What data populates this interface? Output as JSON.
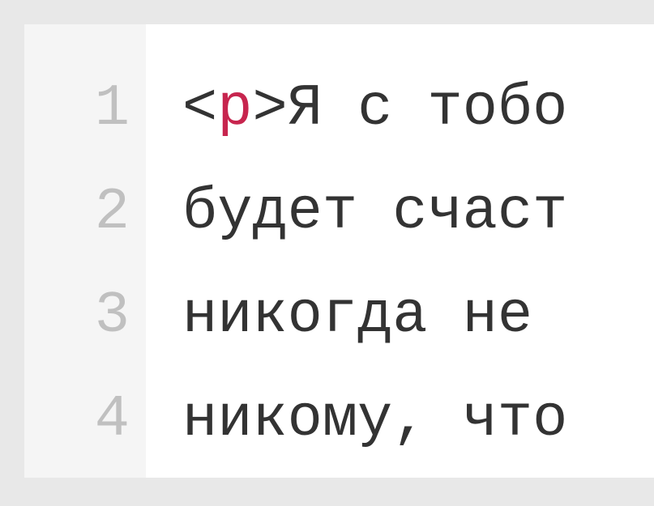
{
  "editor": {
    "lines": [
      {
        "number": "1"
      },
      {
        "number": "2"
      },
      {
        "number": "3"
      },
      {
        "number": "4"
      }
    ],
    "code": {
      "line1": {
        "bracket_open": "<",
        "tag": "p",
        "bracket_close": ">",
        "text": "Я с тобо"
      },
      "line2": {
        "text": "будет счаст"
      },
      "line3": {
        "text": "никогда не "
      },
      "line4": {
        "text": "никому, что"
      }
    }
  }
}
